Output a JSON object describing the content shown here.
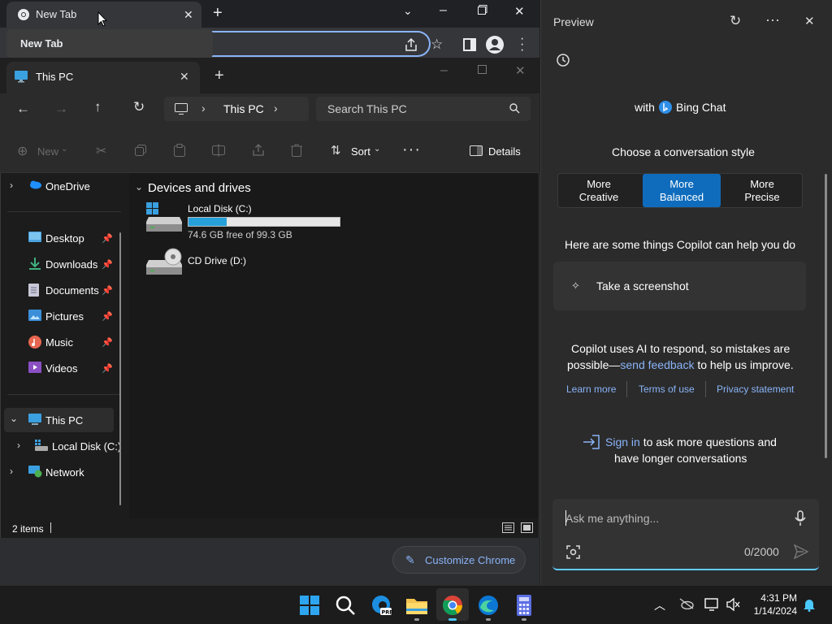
{
  "chrome": {
    "tab_title": "New Tab",
    "tooltip_title": "New Tab",
    "customize_label": "Customize Chrome"
  },
  "explorer": {
    "tab_title": "This PC",
    "address": {
      "segments": [
        "This PC"
      ]
    },
    "search_placeholder": "Search This PC",
    "toolbar": {
      "new_label": "New",
      "sort_label": "Sort",
      "details_label": "Details"
    },
    "sidebar": {
      "onedrive": "OneDrive",
      "quick_access": [
        {
          "label": "Desktop",
          "icon": "desktop-icon"
        },
        {
          "label": "Downloads",
          "icon": "download-icon"
        },
        {
          "label": "Documents",
          "icon": "document-icon"
        },
        {
          "label": "Pictures",
          "icon": "pictures-icon"
        },
        {
          "label": "Music",
          "icon": "music-icon"
        },
        {
          "label": "Videos",
          "icon": "video-icon"
        }
      ],
      "this_pc": "This PC",
      "local_disk": "Local Disk (C:)",
      "network": "Network"
    },
    "content": {
      "group_title": "Devices and drives",
      "drives": [
        {
          "name": "Local Disk (C:)",
          "free_text": "74.6 GB free of 99.3 GB",
          "used_fraction": 0.25
        },
        {
          "name": "CD Drive (D:)"
        }
      ]
    },
    "status": {
      "items_text": "2 items"
    }
  },
  "copilot": {
    "title": "Preview",
    "with_text": "with",
    "brand": "Bing Chat",
    "choose_style": "Choose a conversation style",
    "styles": [
      {
        "line1": "More",
        "line2": "Creative"
      },
      {
        "line1": "More",
        "line2": "Balanced"
      },
      {
        "line1": "More",
        "line2": "Precise"
      }
    ],
    "help_heading": "Here are some things Copilot can help you do",
    "suggestion": "Take a screenshot",
    "disclaimer_1": "Copilot uses AI to respond, so mistakes are",
    "disclaimer_2a": "possible—",
    "disclaimer_link": "send feedback",
    "disclaimer_2b": " to help us improve.",
    "links": [
      "Learn more",
      "Terms of use",
      "Privacy statement"
    ],
    "signin_link": "Sign in",
    "signin_text_1": " to ask more questions and",
    "signin_text_2": "have longer conversations",
    "input_placeholder": "Ask me anything...",
    "char_count": "0/2000"
  },
  "taskbar": {
    "time": "4:31 PM",
    "date": "1/14/2024"
  },
  "colors": {
    "accent": "#0f6cbd",
    "link": "#8ab4f8",
    "drive_bar": "#26a0da"
  }
}
